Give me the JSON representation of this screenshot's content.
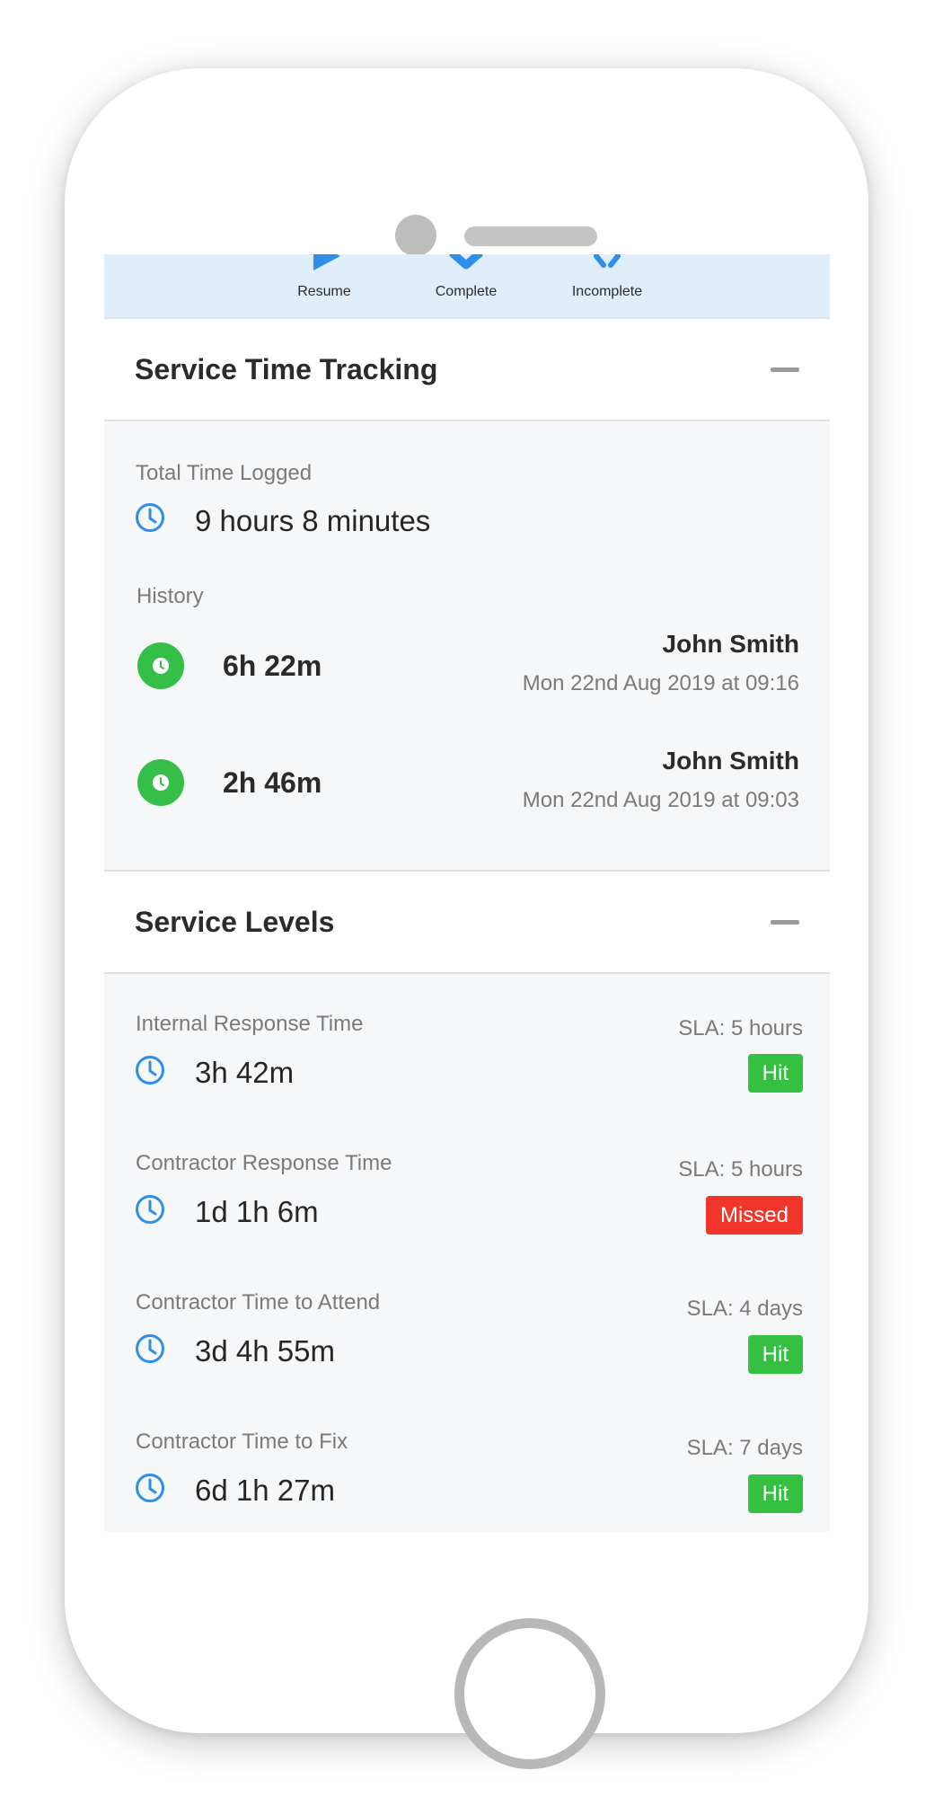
{
  "actions": {
    "resume": "Resume",
    "complete": "Complete",
    "incomplete": "Incomplete"
  },
  "time_tracking": {
    "title": "Service Time Tracking",
    "total_label": "Total Time Logged",
    "total_value": "9 hours 8 minutes",
    "history_label": "History",
    "history": [
      {
        "duration": "6h 22m",
        "name": "John Smith",
        "date": "Mon 22nd Aug 2019 at 09:16"
      },
      {
        "duration": "2h 46m",
        "name": "John Smith",
        "date": "Mon 22nd Aug 2019 at 09:03"
      }
    ]
  },
  "service_levels": {
    "title": "Service Levels",
    "items": [
      {
        "label": "Internal Response Time",
        "value": "3h 42m",
        "sla": "SLA: 5 hours",
        "status": "Hit"
      },
      {
        "label": "Contractor Response Time",
        "value": "1d 1h 6m",
        "sla": "SLA: 5 hours",
        "status": "Missed"
      },
      {
        "label": "Contractor Time to Attend",
        "value": "3d 4h 55m",
        "sla": "SLA: 4 days",
        "status": "Hit"
      },
      {
        "label": "Contractor Time to Fix",
        "value": "6d 1h 27m",
        "sla": "SLA: 7 days",
        "status": "Hit"
      }
    ]
  },
  "colors": {
    "accent_blue": "#2f8fe8",
    "hit_green": "#34c041",
    "missed_red": "#f2352a",
    "history_green": "#36bf48"
  },
  "icons": {
    "resume": "play-icon",
    "complete": "check-icon",
    "incomplete": "cross-icon",
    "time": "clock-icon"
  }
}
